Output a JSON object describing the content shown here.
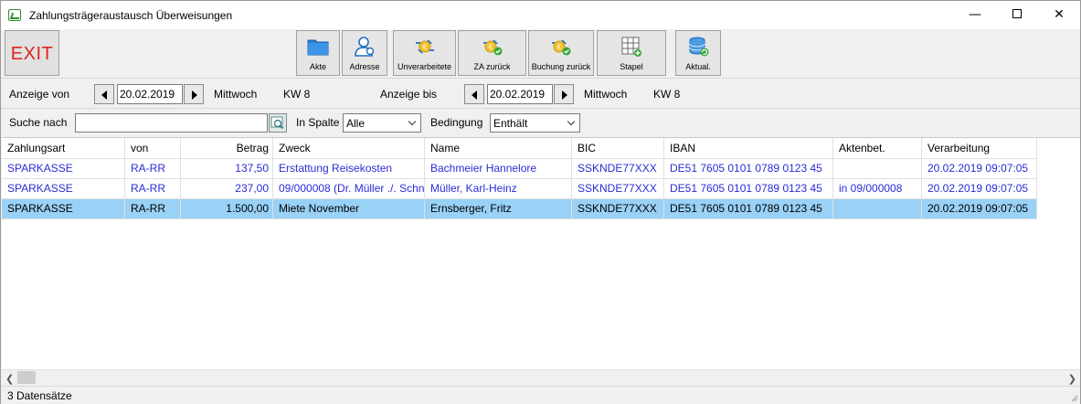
{
  "window": {
    "title": "Zahlungsträgeraustausch Überweisungen"
  },
  "toolbar": {
    "exit_label": "EXIT",
    "buttons": [
      {
        "label": "Akte",
        "icon": "folder-icon"
      },
      {
        "label": "Adresse",
        "icon": "person-icon"
      },
      {
        "label": "Unverarbeitete",
        "icon": "euro-exchange-icon"
      },
      {
        "label": "ZA zurück",
        "icon": "euro-check-icon"
      },
      {
        "label": "Buchung zurück",
        "icon": "euro-check-icon"
      },
      {
        "label": "Stapel",
        "icon": "grid-add-icon"
      },
      {
        "label": "Aktual.",
        "icon": "database-refresh-icon"
      }
    ]
  },
  "filter": {
    "anzeige_von_label": "Anzeige von",
    "von_date": "20.02.2019",
    "von_weekday": "Mittwoch",
    "von_kw": "KW 8",
    "anzeige_bis_label": "Anzeige bis",
    "bis_date": "20.02.2019",
    "bis_weekday": "Mittwoch",
    "bis_kw": "KW 8",
    "suche_label": "Suche nach",
    "suche_value": "",
    "spalte_label": "In Spalte",
    "spalte_value": "Alle",
    "bedingung_label": "Bedingung",
    "bedingung_value": "Enthält"
  },
  "grid": {
    "columns": [
      "Zahlungsart",
      "von",
      "Betrag",
      "Zweck",
      "Name",
      "BIC",
      "IBAN",
      "Aktenbet.",
      "Verarbeitung"
    ],
    "rows": [
      [
        "SPARKASSE",
        "RA-RR",
        "137,50",
        "Erstattung Reisekosten",
        "Bachmeier Hannelore",
        "SSKNDE77XXX",
        "DE51 7605 0101 0789 0123 45",
        "",
        "20.02.2019 09:07:05"
      ],
      [
        "SPARKASSE",
        "RA-RR",
        "237,00",
        "09/000008 (Dr. Müller ./. Schn",
        "Müller, Karl-Heinz",
        "SSKNDE77XXX",
        "DE51 7605 0101 0789 0123 45",
        "in 09/000008",
        "20.02.2019 09:07:05"
      ],
      [
        "SPARKASSE",
        "RA-RR",
        "1.500,00",
        "Miete November",
        "Ernsberger, Fritz",
        "SSKNDE77XXX",
        "DE51 7605 0101 0789 0123 45",
        "",
        "20.02.2019 09:07:05"
      ]
    ],
    "selected_row": 2
  },
  "status": {
    "count_text": "3 Datensätze"
  },
  "colors": {
    "row_text": "#2b2bd6",
    "selected_bg": "#99d1f7",
    "exit_red": "#e3211b"
  }
}
